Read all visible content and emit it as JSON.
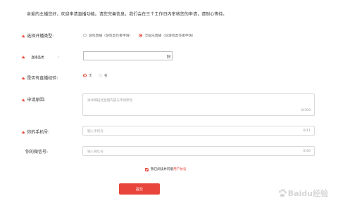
{
  "intro": "亲爱的主播您好，欢迎申请直播功能。请您完善信息，我们会在三个工作日内审核您的申请，请耐心等待。",
  "required_mark": "★",
  "broadcast_type": {
    "label": "选择开播类型:",
    "options": [
      {
        "label": "游戏直播（游戏类作者申请）",
        "checked": false
      },
      {
        "label": "泛娱乐直播（非游戏类作者申请）",
        "checked": true
      }
    ]
  },
  "category": {
    "label": "直播品类",
    "colon": ":",
    "selected": ""
  },
  "experience": {
    "label": "是否有直播经验:",
    "options": [
      {
        "label": "无",
        "checked": true
      },
      {
        "label": "有",
        "checked": false
      }
    ]
  },
  "reason": {
    "label": "申请原因:",
    "placeholder": "请详细描述直播内容与申请原因",
    "counter": "0/300"
  },
  "phone": {
    "label": "你的手机号:",
    "placeholder": "输入手机号",
    "counter": "0/11"
  },
  "wechat": {
    "label": "你的微信号:",
    "placeholder": "输入微信号",
    "counter": "0/40"
  },
  "agreement": {
    "text": "我已阅读并同意用户协议",
    "link": "用户协议",
    "checked": true
  },
  "submit_label": "提交",
  "watermark": "Baidu经验",
  "colors": {
    "accent": "#e8463c",
    "border": "#d9d9d9",
    "placeholder": "#aaaaaa"
  }
}
